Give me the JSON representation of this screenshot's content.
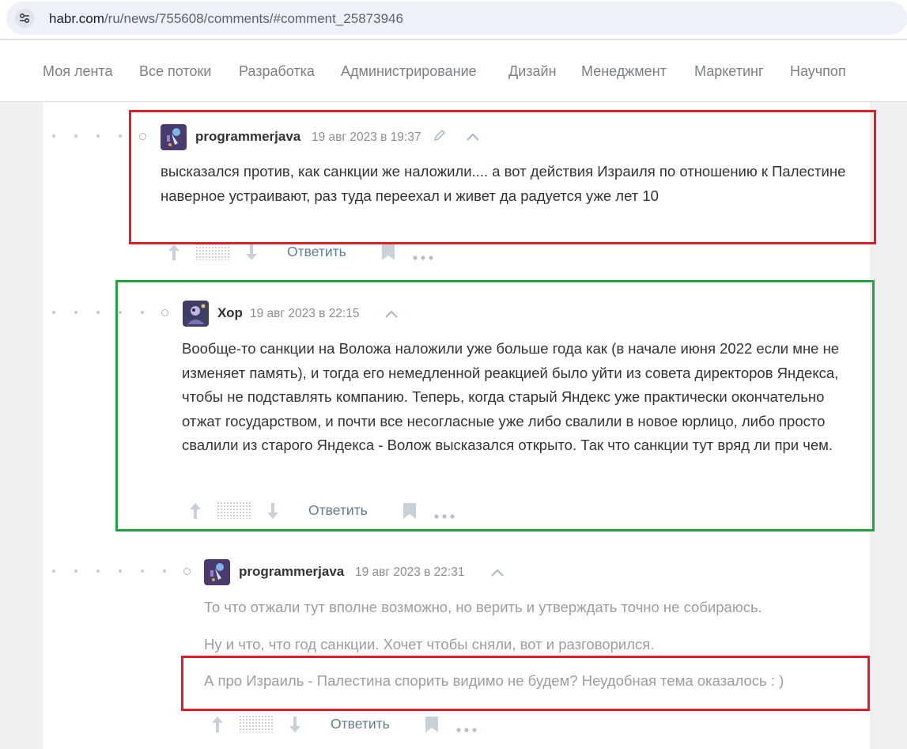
{
  "browser": {
    "url_host": "habr.com",
    "url_path": "/ru/news/755608/comments/#comment_25873946",
    "site_info_icon": "tune-icon"
  },
  "nav": {
    "items": [
      "Моя лента",
      "Все потоки",
      "Разработка",
      "Администрирование",
      "Дизайн",
      "Менеджмент",
      "Маркетинг",
      "Научпоп"
    ]
  },
  "comments": [
    {
      "author": "programmerjava",
      "time": "19 авг 2023 в 19:37",
      "edited_icon": "pencil-icon",
      "paragraphs": [
        "высказался против, как санкции же наложили.... а вот действия Израиля по отношению к Палестине наверное устраивают, раз туда переехал и живет да радуется уже лет 10"
      ],
      "reply_label": "Ответить"
    },
    {
      "author": "Хор",
      "time": "19 авг 2023 в 22:15",
      "paragraphs": [
        "Вообще-то санкции на Воложа наложили уже больше года как (в начале июня 2022 если мне не изменяет память), и тогда его немедленной реакцией было уйти из совета директоров Яндекса, чтобы не подставлять компанию. Теперь, когда старый Яндекс уже практически окончательно отжат государством, и почти все несогласные уже либо свалили в новое юрлицо, либо просто свалили из старого Яндекса - Волож высказался открыто. Так что санкции тут вряд ли при чем."
      ],
      "reply_label": "Ответить"
    },
    {
      "author": "programmerjava",
      "time": "19 авг 2023 в 22:31",
      "paragraphs": [
        "То что отжали тут вполне возможно, но верить и утверждать точно не собираюсь.",
        "Ну и что, что год санкции. Хочет чтобы сняли, вот и разговорился.",
        "А про Израиль - Палестина спорить видимо не будем? Неудобная тема оказалось : )"
      ],
      "reply_label": "Ответить"
    }
  ],
  "highlight_colors": {
    "red": "#e21d2a",
    "green": "#22a43c"
  }
}
